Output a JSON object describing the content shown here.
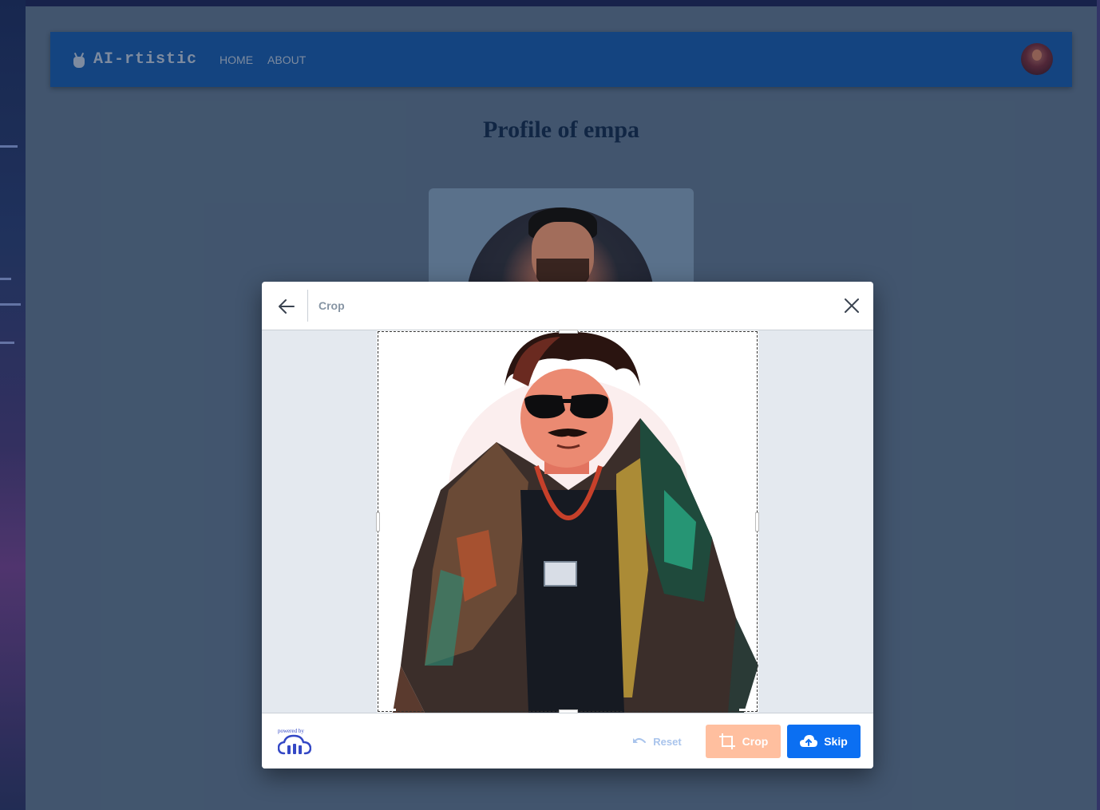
{
  "app": {
    "brand": "AI-rtistic",
    "nav": [
      "HOME",
      "ABOUT"
    ]
  },
  "page": {
    "title": "Profile of empa"
  },
  "modal": {
    "title": "Crop",
    "powered_by": "powered by",
    "buttons": {
      "reset": "Reset",
      "crop": "Crop",
      "skip": "Skip"
    }
  },
  "colors": {
    "navbar": "#164c8c",
    "page_bg": "#4a5f78",
    "crop_button": "#ffbf9f",
    "skip_button": "#0b6ff2",
    "reset_text": "#a9c4ec"
  },
  "icons": [
    "robot-icon",
    "avatar",
    "back-arrow-icon",
    "close-icon",
    "undo-icon",
    "crop-icon",
    "cloud-upload-icon",
    "cloudinary-logo"
  ]
}
